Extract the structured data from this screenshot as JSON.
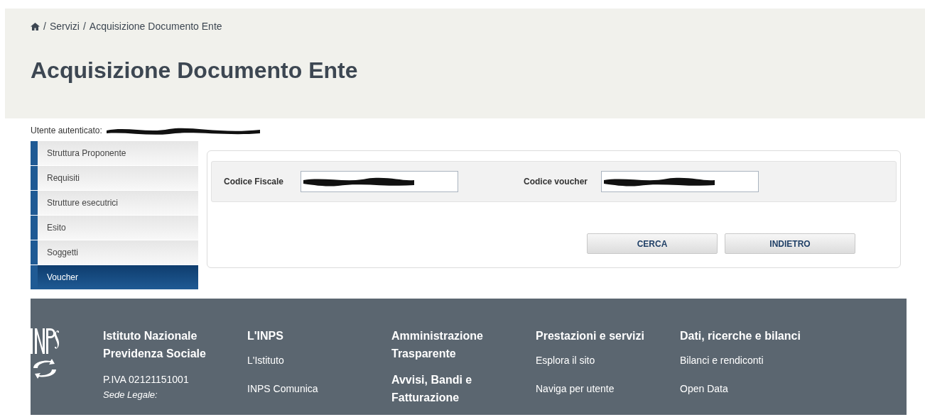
{
  "breadcrumb": {
    "separator": "/",
    "items": [
      "Servizi",
      "Acquisizione Documento Ente"
    ]
  },
  "title": "Acquisizione Documento Ente",
  "user": {
    "label": "Utente autenticato:"
  },
  "sidebar": {
    "items": [
      {
        "label": "Struttura Proponente",
        "selected": false
      },
      {
        "label": "Requisiti",
        "selected": false
      },
      {
        "label": "Strutture esecutrici",
        "selected": false
      },
      {
        "label": "Esito",
        "selected": false
      },
      {
        "label": "Soggetti",
        "selected": false
      },
      {
        "label": "Voucher",
        "selected": true
      }
    ]
  },
  "form": {
    "fields": [
      {
        "label": "Codice Fiscale"
      },
      {
        "label": "Codice voucher"
      }
    ],
    "buttons": [
      "CERCA",
      "INDIETRO"
    ]
  },
  "footer": {
    "columns": [
      {
        "items": [
          {
            "kind": "heading",
            "text": "Istituto Nazionale Previdenza Sociale"
          },
          {
            "kind": "text",
            "text": "P.IVA 02121151001"
          },
          {
            "kind": "note",
            "text": "Sede Legale:"
          }
        ]
      },
      {
        "items": [
          {
            "kind": "heading",
            "text": "L'INPS"
          },
          {
            "kind": "link",
            "text": "L'Istituto"
          },
          {
            "kind": "link",
            "text": "INPS Comunica"
          }
        ]
      },
      {
        "items": [
          {
            "kind": "heading",
            "text": "Amministrazione Trasparente"
          },
          {
            "kind": "heading",
            "text": "Avvisi, Bandi e Fatturazione"
          }
        ]
      },
      {
        "items": [
          {
            "kind": "heading",
            "text": "Prestazioni e servizi"
          },
          {
            "kind": "link",
            "text": "Esplora il sito"
          },
          {
            "kind": "link",
            "text": "Naviga per utente"
          }
        ]
      },
      {
        "items": [
          {
            "kind": "heading",
            "text": "Dati, ricerche e bilanci"
          },
          {
            "kind": "link",
            "text": "Bilanci e rendiconti"
          },
          {
            "kind": "link",
            "text": "Open Data"
          }
        ]
      }
    ]
  }
}
